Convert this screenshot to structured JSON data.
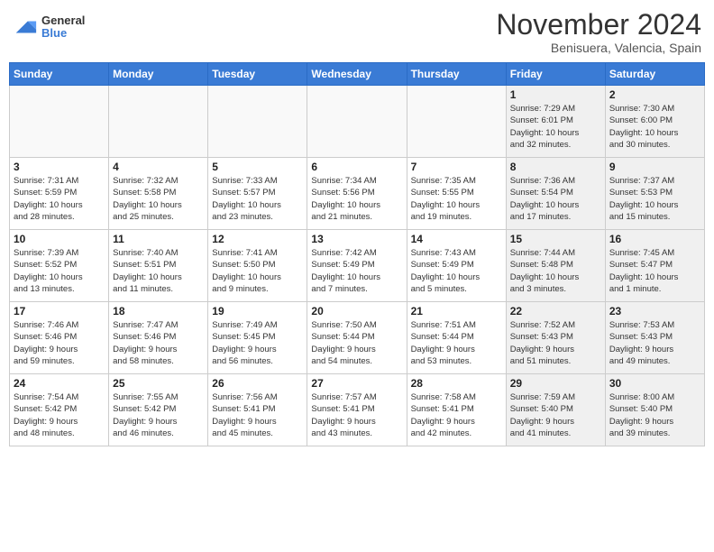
{
  "header": {
    "logo": {
      "general": "General",
      "blue": "Blue"
    },
    "month": "November 2024",
    "location": "Benisuera, Valencia, Spain"
  },
  "weekdays": [
    "Sunday",
    "Monday",
    "Tuesday",
    "Wednesday",
    "Thursday",
    "Friday",
    "Saturday"
  ],
  "weeks": [
    [
      {
        "day": "",
        "info": ""
      },
      {
        "day": "",
        "info": ""
      },
      {
        "day": "",
        "info": ""
      },
      {
        "day": "",
        "info": ""
      },
      {
        "day": "",
        "info": ""
      },
      {
        "day": "1",
        "info": "Sunrise: 7:29 AM\nSunset: 6:01 PM\nDaylight: 10 hours\nand 32 minutes."
      },
      {
        "day": "2",
        "info": "Sunrise: 7:30 AM\nSunset: 6:00 PM\nDaylight: 10 hours\nand 30 minutes."
      }
    ],
    [
      {
        "day": "3",
        "info": "Sunrise: 7:31 AM\nSunset: 5:59 PM\nDaylight: 10 hours\nand 28 minutes."
      },
      {
        "day": "4",
        "info": "Sunrise: 7:32 AM\nSunset: 5:58 PM\nDaylight: 10 hours\nand 25 minutes."
      },
      {
        "day": "5",
        "info": "Sunrise: 7:33 AM\nSunset: 5:57 PM\nDaylight: 10 hours\nand 23 minutes."
      },
      {
        "day": "6",
        "info": "Sunrise: 7:34 AM\nSunset: 5:56 PM\nDaylight: 10 hours\nand 21 minutes."
      },
      {
        "day": "7",
        "info": "Sunrise: 7:35 AM\nSunset: 5:55 PM\nDaylight: 10 hours\nand 19 minutes."
      },
      {
        "day": "8",
        "info": "Sunrise: 7:36 AM\nSunset: 5:54 PM\nDaylight: 10 hours\nand 17 minutes."
      },
      {
        "day": "9",
        "info": "Sunrise: 7:37 AM\nSunset: 5:53 PM\nDaylight: 10 hours\nand 15 minutes."
      }
    ],
    [
      {
        "day": "10",
        "info": "Sunrise: 7:39 AM\nSunset: 5:52 PM\nDaylight: 10 hours\nand 13 minutes."
      },
      {
        "day": "11",
        "info": "Sunrise: 7:40 AM\nSunset: 5:51 PM\nDaylight: 10 hours\nand 11 minutes."
      },
      {
        "day": "12",
        "info": "Sunrise: 7:41 AM\nSunset: 5:50 PM\nDaylight: 10 hours\nand 9 minutes."
      },
      {
        "day": "13",
        "info": "Sunrise: 7:42 AM\nSunset: 5:49 PM\nDaylight: 10 hours\nand 7 minutes."
      },
      {
        "day": "14",
        "info": "Sunrise: 7:43 AM\nSunset: 5:49 PM\nDaylight: 10 hours\nand 5 minutes."
      },
      {
        "day": "15",
        "info": "Sunrise: 7:44 AM\nSunset: 5:48 PM\nDaylight: 10 hours\nand 3 minutes."
      },
      {
        "day": "16",
        "info": "Sunrise: 7:45 AM\nSunset: 5:47 PM\nDaylight: 10 hours\nand 1 minute."
      }
    ],
    [
      {
        "day": "17",
        "info": "Sunrise: 7:46 AM\nSunset: 5:46 PM\nDaylight: 9 hours\nand 59 minutes."
      },
      {
        "day": "18",
        "info": "Sunrise: 7:47 AM\nSunset: 5:46 PM\nDaylight: 9 hours\nand 58 minutes."
      },
      {
        "day": "19",
        "info": "Sunrise: 7:49 AM\nSunset: 5:45 PM\nDaylight: 9 hours\nand 56 minutes."
      },
      {
        "day": "20",
        "info": "Sunrise: 7:50 AM\nSunset: 5:44 PM\nDaylight: 9 hours\nand 54 minutes."
      },
      {
        "day": "21",
        "info": "Sunrise: 7:51 AM\nSunset: 5:44 PM\nDaylight: 9 hours\nand 53 minutes."
      },
      {
        "day": "22",
        "info": "Sunrise: 7:52 AM\nSunset: 5:43 PM\nDaylight: 9 hours\nand 51 minutes."
      },
      {
        "day": "23",
        "info": "Sunrise: 7:53 AM\nSunset: 5:43 PM\nDaylight: 9 hours\nand 49 minutes."
      }
    ],
    [
      {
        "day": "24",
        "info": "Sunrise: 7:54 AM\nSunset: 5:42 PM\nDaylight: 9 hours\nand 48 minutes."
      },
      {
        "day": "25",
        "info": "Sunrise: 7:55 AM\nSunset: 5:42 PM\nDaylight: 9 hours\nand 46 minutes."
      },
      {
        "day": "26",
        "info": "Sunrise: 7:56 AM\nSunset: 5:41 PM\nDaylight: 9 hours\nand 45 minutes."
      },
      {
        "day": "27",
        "info": "Sunrise: 7:57 AM\nSunset: 5:41 PM\nDaylight: 9 hours\nand 43 minutes."
      },
      {
        "day": "28",
        "info": "Sunrise: 7:58 AM\nSunset: 5:41 PM\nDaylight: 9 hours\nand 42 minutes."
      },
      {
        "day": "29",
        "info": "Sunrise: 7:59 AM\nSunset: 5:40 PM\nDaylight: 9 hours\nand 41 minutes."
      },
      {
        "day": "30",
        "info": "Sunrise: 8:00 AM\nSunset: 5:40 PM\nDaylight: 9 hours\nand 39 minutes."
      }
    ]
  ]
}
